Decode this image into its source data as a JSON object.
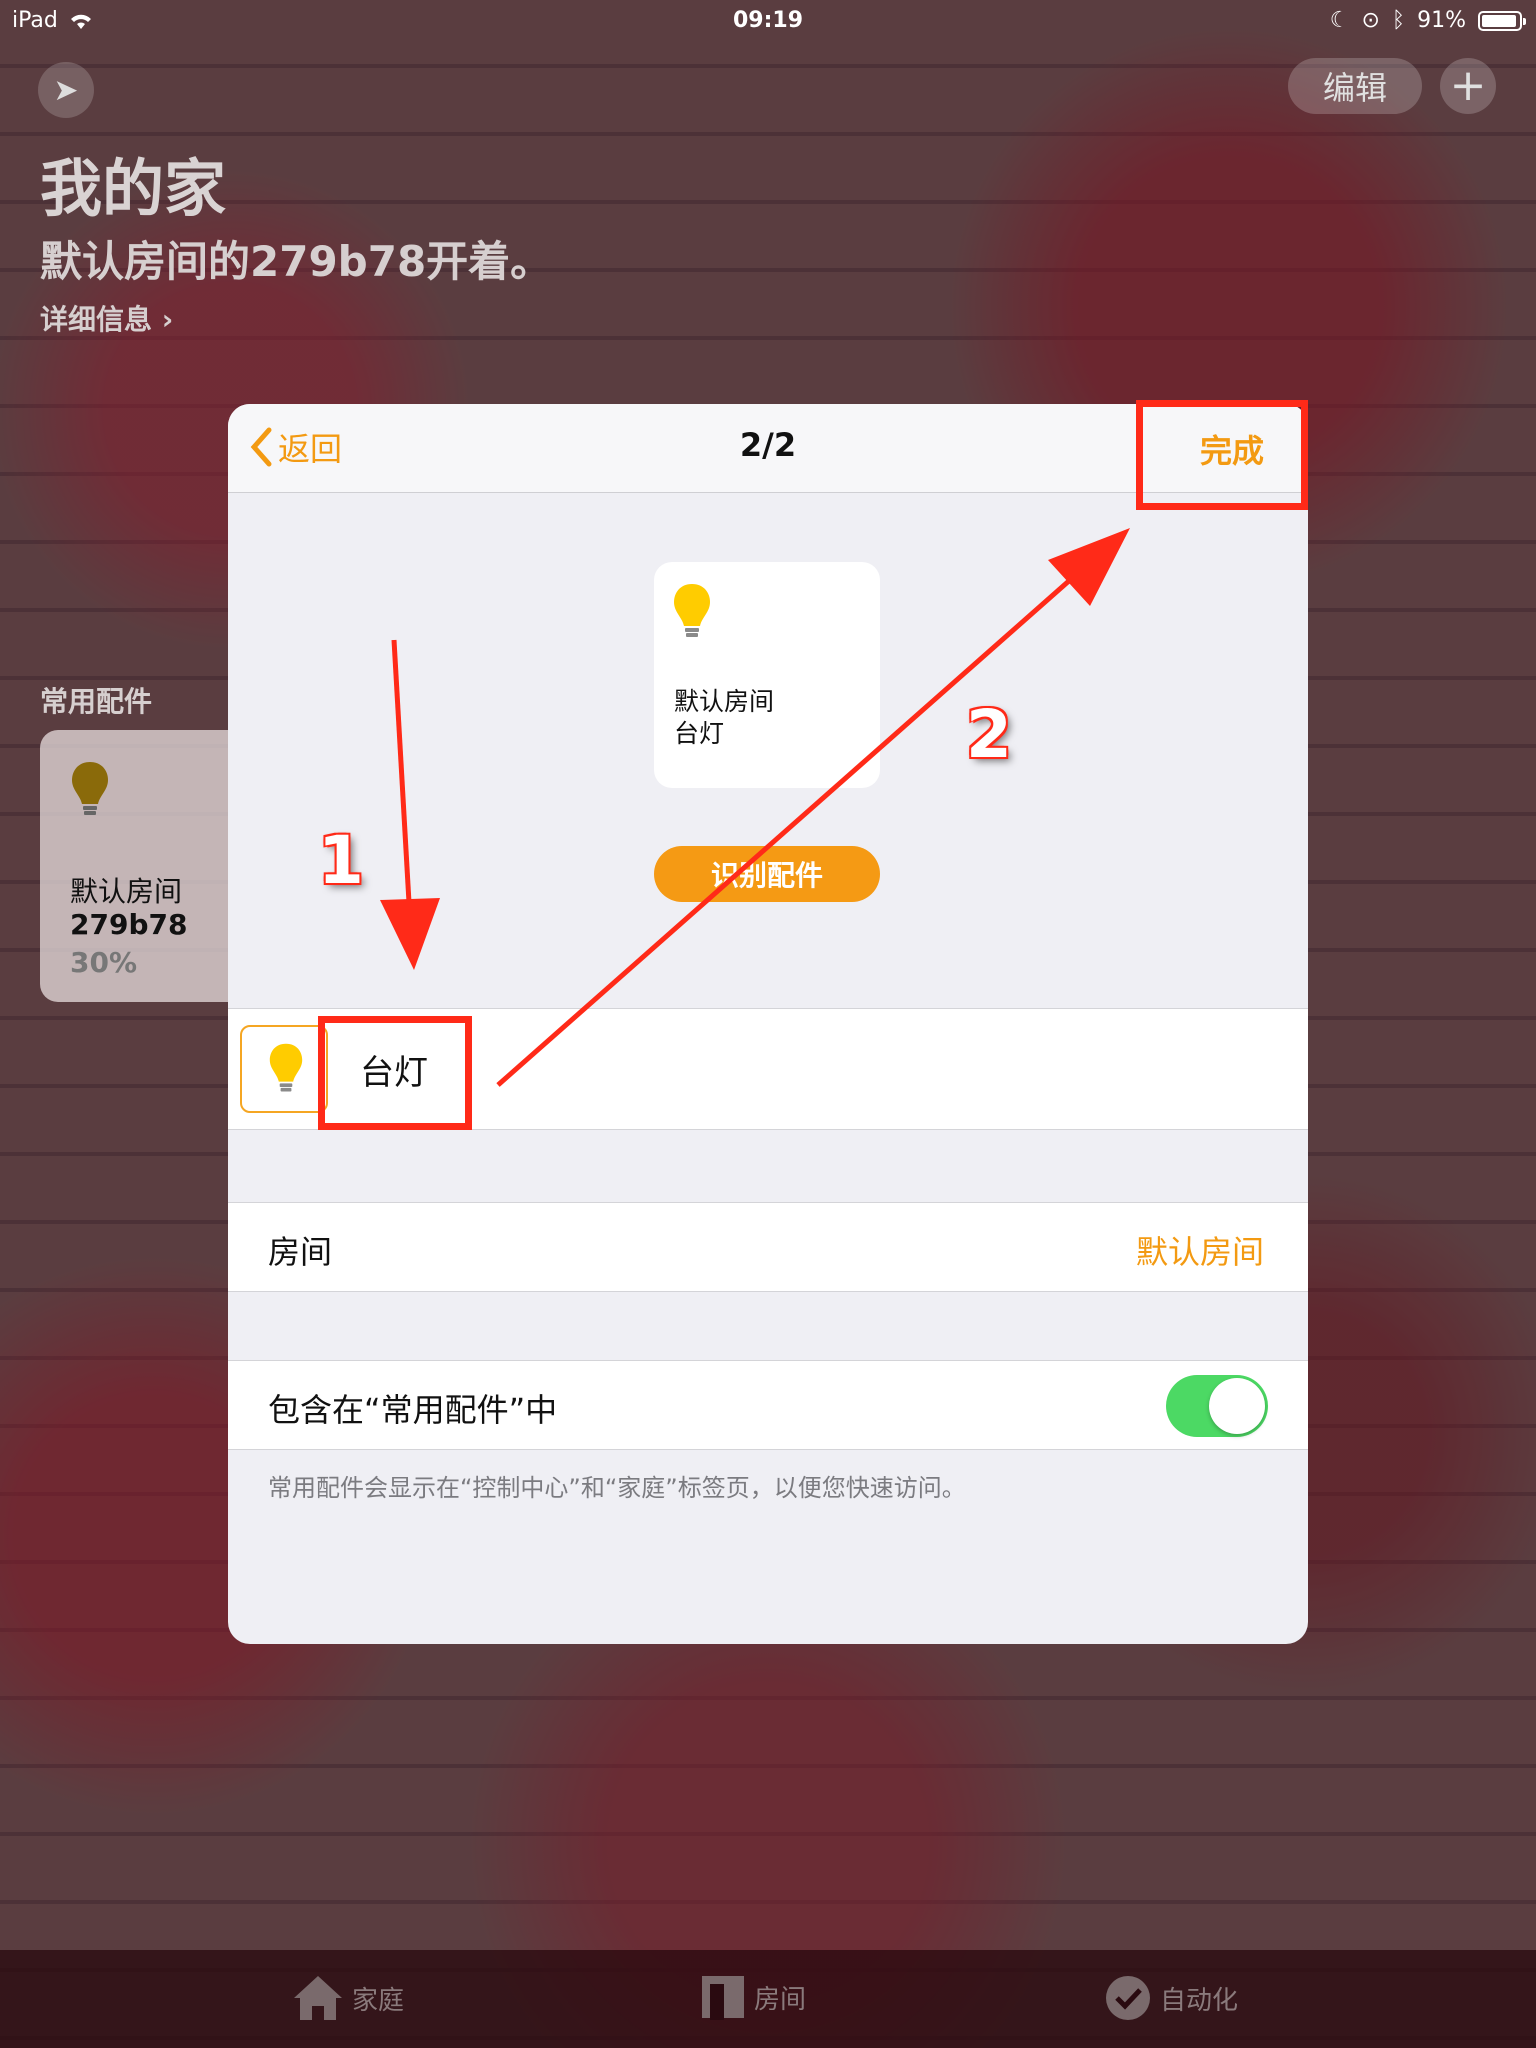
{
  "status_bar": {
    "device": "iPad",
    "time": "09:19",
    "battery": "91%"
  },
  "home": {
    "edit_label": "编辑",
    "add_label": "+",
    "title": "我的家",
    "subtitle": "默认房间的279b78开着。",
    "details_link": "详细信息 ›",
    "favorites_label": "常用配件",
    "favorite_tile": {
      "room": "默认房间",
      "name": "279b78",
      "status": "30%"
    }
  },
  "tabbar": {
    "tabs": [
      {
        "label": "家庭",
        "icon": "house-icon"
      },
      {
        "label": "房间",
        "icon": "rooms-icon"
      },
      {
        "label": "自动化",
        "icon": "automation-icon"
      }
    ]
  },
  "modal": {
    "back_label": "返回",
    "title": "2/2",
    "done_label": "完成",
    "preview_tile": {
      "room": "默认房间",
      "name": "台灯"
    },
    "identify_label": "识别配件",
    "accessory_name": "台灯",
    "room_row": {
      "label": "房间",
      "value": "默认房间"
    },
    "favorite_row": {
      "label": "包含在“常用配件”中",
      "enabled": true
    },
    "footnote": "常用配件会显示在“控制中心”和“家庭”标签页，以便您快速访问。"
  },
  "annotations": {
    "step1": "1",
    "step2": "2",
    "color": "#ff2a18"
  },
  "colors": {
    "accent": "#f39a12",
    "toggle_on": "#4cd964",
    "bulb": "#ffcc00"
  }
}
